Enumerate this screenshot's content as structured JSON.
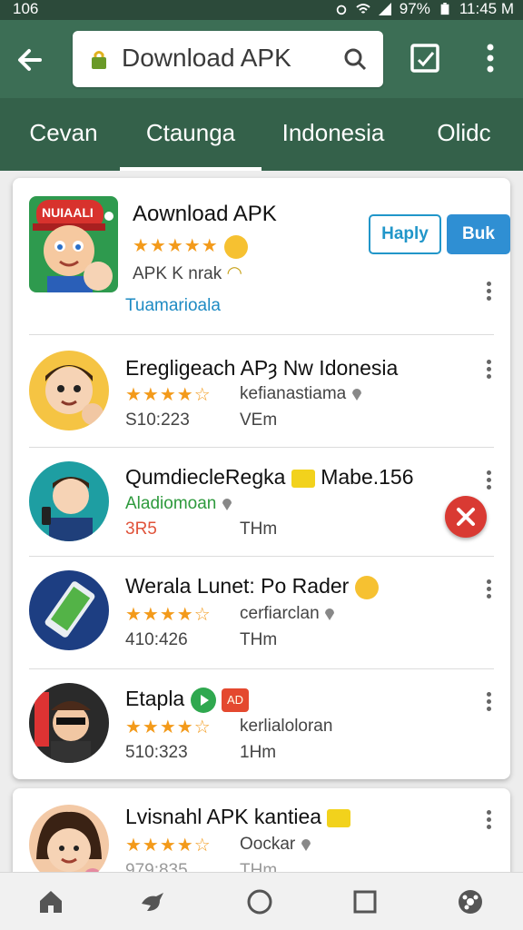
{
  "status_bar": {
    "left_text": "106",
    "battery": "97%",
    "time": "11:45 M"
  },
  "toolbar": {
    "search_query": "Download APK"
  },
  "tabs": [
    {
      "label": "Cevan"
    },
    {
      "label": "Ctaunga"
    },
    {
      "label": "Indonesia"
    },
    {
      "label": "Olidc"
    }
  ],
  "active_tab": "Ctaunga",
  "featured": {
    "title": "Aownload APK",
    "icon_text": "NUIAALI",
    "rating_stars": "★★★★★",
    "subtitle": "APK K nrak",
    "developer": "Tuamarioala",
    "button_outline": "Haply",
    "button_fill": "Buk"
  },
  "apps": [
    {
      "title": "Eregligeach APȝ Nw Idonesia",
      "stars": "★★★★☆",
      "meta": "kefianastiama",
      "size": "S10:223",
      "unit": "VEm"
    },
    {
      "title": "QumdiecleRegka",
      "extra": "Mabe.156",
      "dev": "Aladiomoan",
      "size": "3R5",
      "unit": "THm"
    },
    {
      "title": "Werala Lunet: Po Rader",
      "stars": "★★★★☆",
      "meta": "cerfiarclan",
      "size": "410:426",
      "unit": "THm"
    },
    {
      "title": "Etapla",
      "ad_label": "AD",
      "stars": "★★★★☆",
      "meta": "kerlialoloran",
      "size": "510:323",
      "unit": "1Hm"
    },
    {
      "title": "Lvisnahl APK kantiea",
      "stars": "★★★★☆",
      "meta": "Oockar",
      "size": "979:835",
      "unit": "THm"
    }
  ],
  "colors": {
    "toolbar": "#3c6e55",
    "tabs": "#34614a",
    "accent_blue": "#2f8fd3",
    "star": "#f39a1a",
    "green_text": "#2e9a3d",
    "red_text": "#e0533a"
  }
}
